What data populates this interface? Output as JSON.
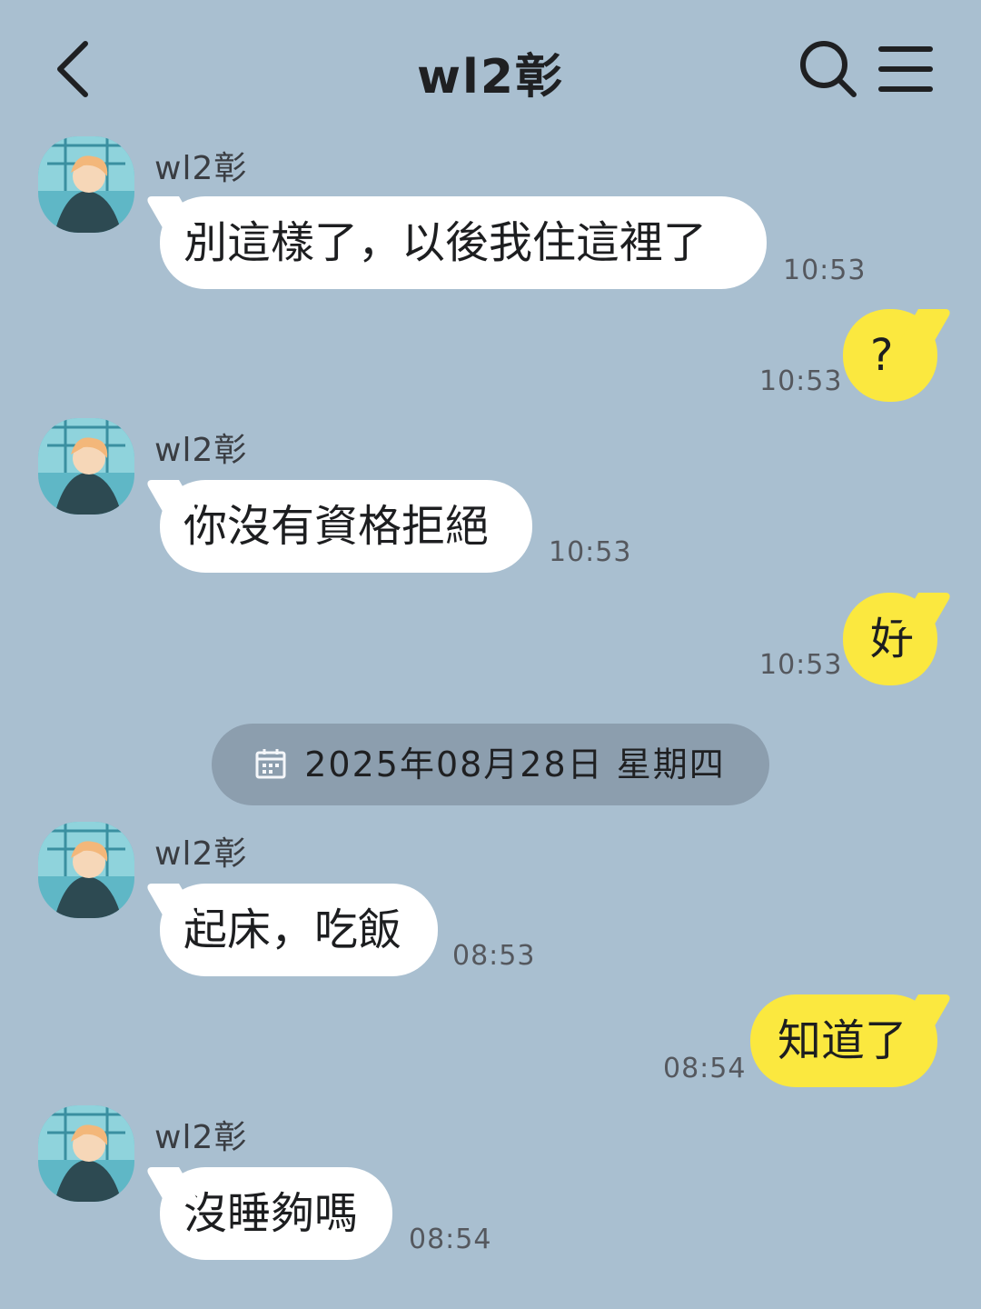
{
  "header": {
    "title": "wl2彰",
    "back_icon": "chevron-left-icon",
    "search_icon": "search-icon",
    "menu_icon": "menu-icon"
  },
  "date_separator": {
    "text": "2025年08月28日  星期四",
    "icon": "calendar-icon"
  },
  "colors": {
    "background": "#a9bfd0",
    "incoming_bubble": "#ffffff",
    "outgoing_bubble": "#fbe83f",
    "date_pill": "#8c9eae"
  },
  "messages": [
    {
      "side": "in",
      "sender": "wl2彰",
      "text": "別這樣了，以後我住這裡了",
      "time": "10:53"
    },
    {
      "side": "out",
      "text": "?",
      "time": "10:53"
    },
    {
      "side": "in",
      "sender": "wl2彰",
      "text": "你沒有資格拒絕",
      "time": "10:53"
    },
    {
      "side": "out",
      "text": "好",
      "time": "10:53"
    },
    {
      "side": "in",
      "sender": "wl2彰",
      "text": "起床，吃飯",
      "time": "08:53"
    },
    {
      "side": "out",
      "text": "知道了",
      "time": "08:54"
    },
    {
      "side": "in",
      "sender": "wl2彰",
      "text": "沒睡夠嗎",
      "time": "08:54"
    }
  ]
}
